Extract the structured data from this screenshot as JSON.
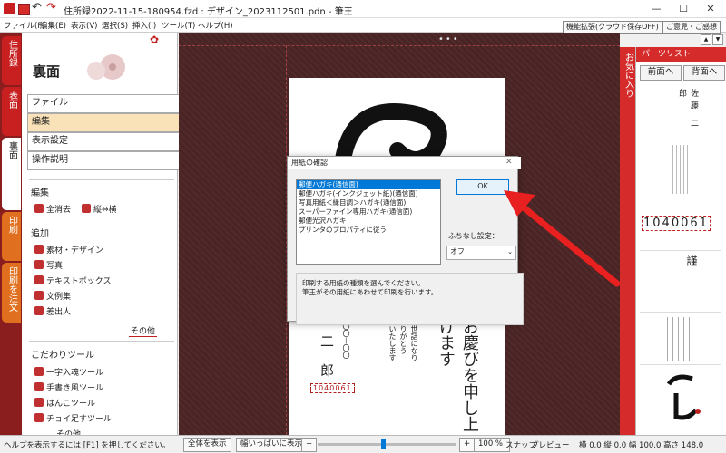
{
  "window": {
    "title": "住所録2022-11-15-180954.fzd : デザイン_2023112501.pdn - 筆王",
    "minimize": "—",
    "maximize": "☐",
    "close": "✕"
  },
  "menubar": {
    "items": [
      "ファイル(F)",
      "編集(E)",
      "表示(V)",
      "選択(S)",
      "挿入(I)",
      "ツール(T)",
      "ヘルプ(H)"
    ],
    "feature_button": "機能拡張(クラウド保存OFF)",
    "feedback_button": "ご意見・ご感想"
  },
  "vtabs": [
    "住所録",
    "表面",
    "裏面",
    "印刷",
    "印刷を注文"
  ],
  "left_panel": {
    "title": "裏面",
    "buttons": [
      "ファイル",
      "編集",
      "表示設定",
      "操作説明"
    ],
    "edit_section": "編集",
    "edit_items": [
      "全消去",
      "縦⇔横"
    ],
    "add_section": "追加",
    "add_items": [
      "素材・デザイン",
      "写真",
      "テキストボックス",
      "文例集",
      "差出人"
    ],
    "other_label": "その他",
    "tools_section": "こだわりツール",
    "tools_items": [
      "一字入魂ツール",
      "手書き風ツール",
      "はんこツール",
      "チョイ足すツール"
    ],
    "more_label": "その他"
  },
  "right_panel": {
    "strip_label": "お気に入り",
    "title": "パーツリスト",
    "front_button": "前面へ",
    "back_button": "背面へ",
    "name_sample": "佐藤 二郎",
    "postal_sample": "1040061"
  },
  "card": {
    "postal_code": "1040061",
    "name_line1": "二",
    "name_line2": "郎",
    "address": "座〇〇—〇〇",
    "greeting": "お慶びを申し上げます",
    "small_lines": [
      "お世話になり",
      "ありがとう",
      "いいたします"
    ]
  },
  "dialog": {
    "title": "用紙の確認",
    "options": [
      "郵便ハガキ(通信面)",
      "郵便ハガキ(インクジェット紙)(通信面)",
      "写真用紙＜縁目調＞ハガキ(通信面)",
      "スーパーファイン専用ハガキ(通信面)",
      "郵便光沢ハガキ",
      "プリンタのプロパティに従う"
    ],
    "ok_label": "OK",
    "border_label": "ふちなし設定：",
    "border_value": "オフ",
    "description": "印刷する用紙の種類を選んでください。\n筆王がその用紙にあわせて印刷を行います。"
  },
  "statusbar": {
    "help": "ヘルプを表示するには [F1] を押してください。",
    "fit_all": "全体を表示",
    "fit_width": "幅いっぱいに表示",
    "zoom_minus": "−",
    "zoom_plus": "+",
    "zoom": "100 %",
    "snap": "スナップ",
    "preview": "プレビュー",
    "coords": "横 0.0 縦 0.0 幅 100.0 高さ 148.0"
  },
  "colors": {
    "accent_red": "#d52b2b",
    "dark_red": "#8a1e1e",
    "canvas_bg": "#4a2424",
    "selection_blue": "#0078d7",
    "arrow_red": "#e8201f"
  }
}
